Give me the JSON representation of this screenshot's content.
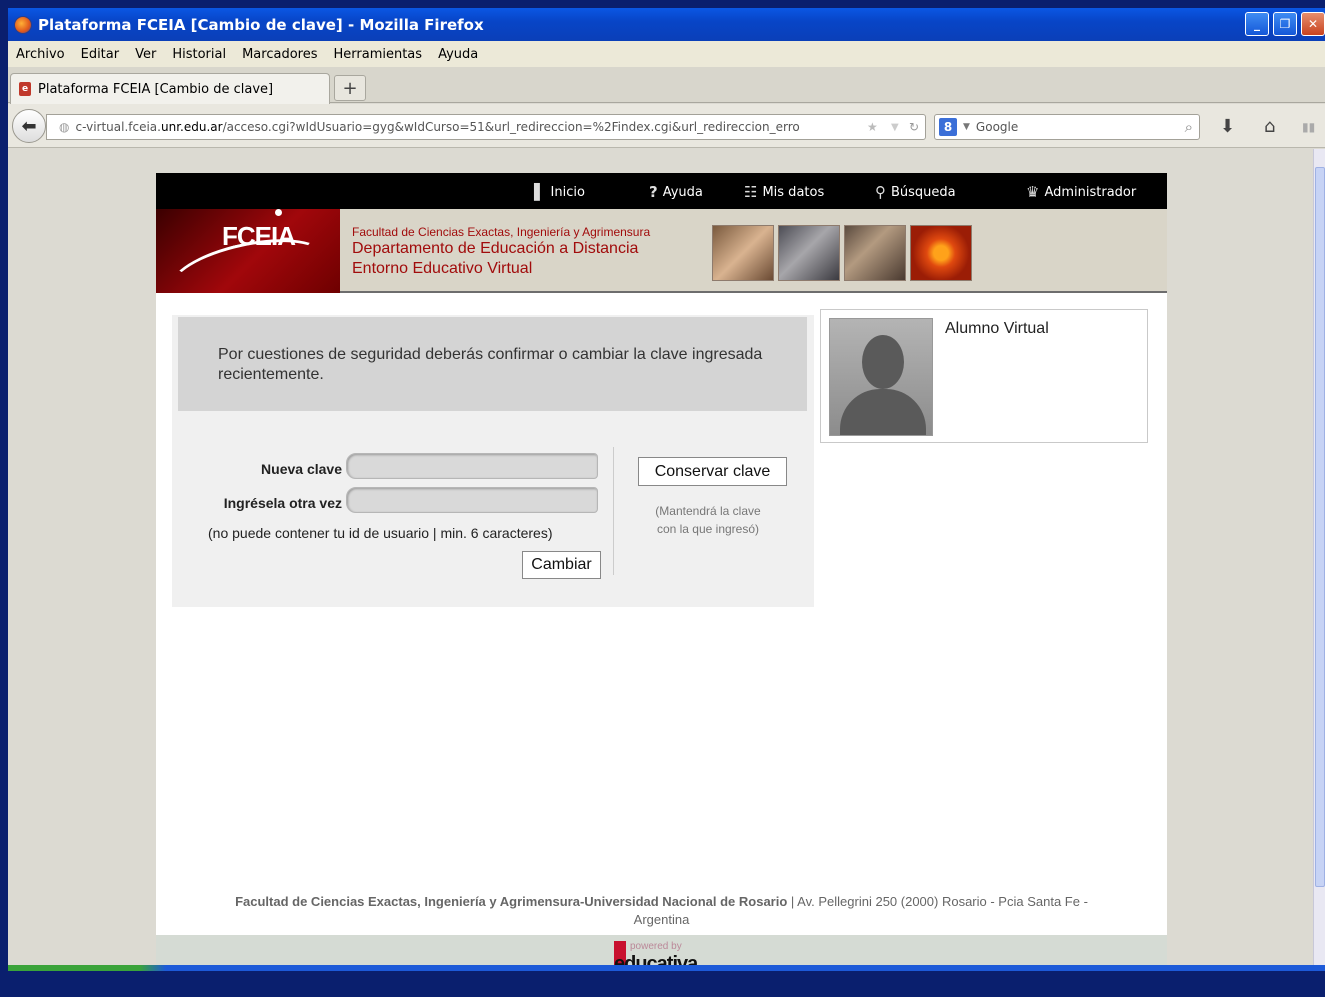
{
  "window": {
    "title": "Plataforma FCEIA [Cambio de clave] - Mozilla Firefox"
  },
  "menu": [
    "Archivo",
    "Editar",
    "Ver",
    "Historial",
    "Marcadores",
    "Herramientas",
    "Ayuda"
  ],
  "tab": {
    "title": "Plataforma FCEIA [Cambio de clave]",
    "new_tab": "+"
  },
  "nav": {
    "url_prefix": "c-virtual.fceia.",
    "url_domain": "unr.edu.ar",
    "url_rest": "/acceso.cgi?wIdUsuario=gyg&wIdCurso=51&url_redireccion=%2Findex.cgi&url_redireccion_erro",
    "search_engine": "Google"
  },
  "site": {
    "topnav": [
      "Inicio",
      "Ayuda",
      "Mis datos",
      "Búsqueda",
      "Administrador"
    ],
    "logo": "FCEIA",
    "banner": {
      "line1": "Facultad de Ciencias Exactas, Ingeniería y Agrimensura",
      "line2": "Departamento de Educación a Distancia",
      "line3": "Entorno Educativo Virtual"
    }
  },
  "form": {
    "notice": "Por cuestiones de seguridad deberás confirmar o cambiar la clave ingresada recientemente.",
    "new_label": "Nueva clave",
    "repeat_label": "Ingrésela otra vez",
    "hint": "(no puede contener tu id de usuario | min. 6 caracteres)",
    "change_button": "Cambiar",
    "keep_button": "Conservar clave",
    "keep_note_1": "(Mantendrá la clave",
    "keep_note_2": "con la que ingresó)"
  },
  "profile": {
    "name": "Alumno Virtual"
  },
  "footer": {
    "institution": "Facultad de Ciencias Exactas, Ingeniería y Agrimensura-Universidad Nacional de Rosario",
    "address": " | Av. Pellegrini 250 (2000) Rosario - Pcia Santa Fe -",
    "country": "Argentina",
    "powered_by": "powered by",
    "brand": "educativa"
  },
  "colors": {
    "accent": "#a10c0c",
    "titlebar": "#0845c7"
  }
}
